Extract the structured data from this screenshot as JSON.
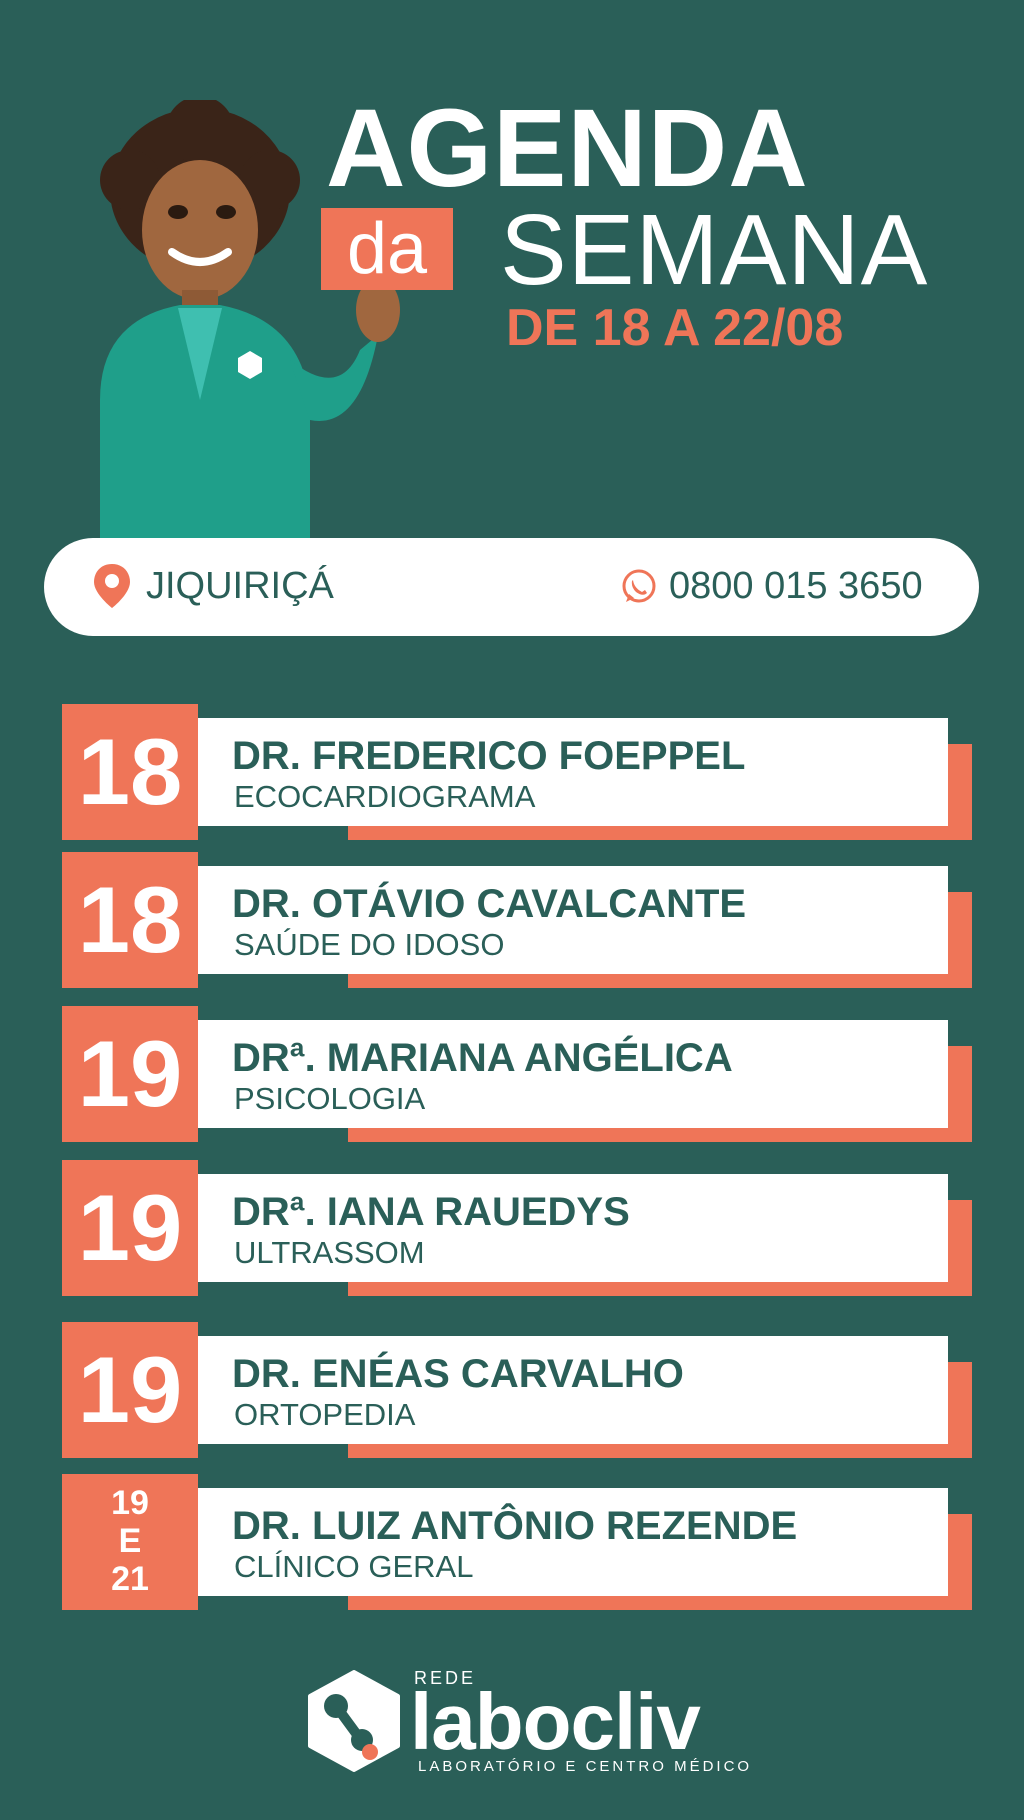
{
  "header": {
    "title": "AGENDA",
    "da": "da",
    "semana": "SEMANA",
    "date_range": "DE 18 A 22/08"
  },
  "info": {
    "city": "JIQUIRIÇÁ",
    "phone": "0800 015 3650",
    "pin_icon": "location-pin-icon",
    "whatsapp_icon": "whatsapp-icon"
  },
  "schedule": [
    {
      "day": "18",
      "doctor": "DR. FREDERICO FOEPPEL",
      "specialty": "ECOCARDIOGRAMA"
    },
    {
      "day": "18",
      "doctor": "DR. OTÁVIO CAVALCANTE",
      "specialty": "SAÚDE DO IDOSO"
    },
    {
      "day": "19",
      "doctor": "DRª. MARIANA ANGÉLICA",
      "specialty": "PSICOLOGIA"
    },
    {
      "day": "19",
      "doctor": "DRª. IANA RAUEDYS",
      "specialty": "ULTRASSOM"
    },
    {
      "day": "19",
      "doctor": "DR. ENÉAS CARVALHO",
      "specialty": "ORTOPEDIA"
    },
    {
      "day_lines": [
        "19",
        "E",
        "21"
      ],
      "doctor": "DR. LUIZ ANTÔNIO REZENDE",
      "specialty": "CLÍNICO GERAL"
    }
  ],
  "logo": {
    "rede": "REDE",
    "name": "labocliv",
    "subtitle": "LABORATÓRIO E CENTRO MÉDICO"
  },
  "colors": {
    "background": "#2a5f58",
    "accent": "#ef7558",
    "white": "#ffffff"
  }
}
